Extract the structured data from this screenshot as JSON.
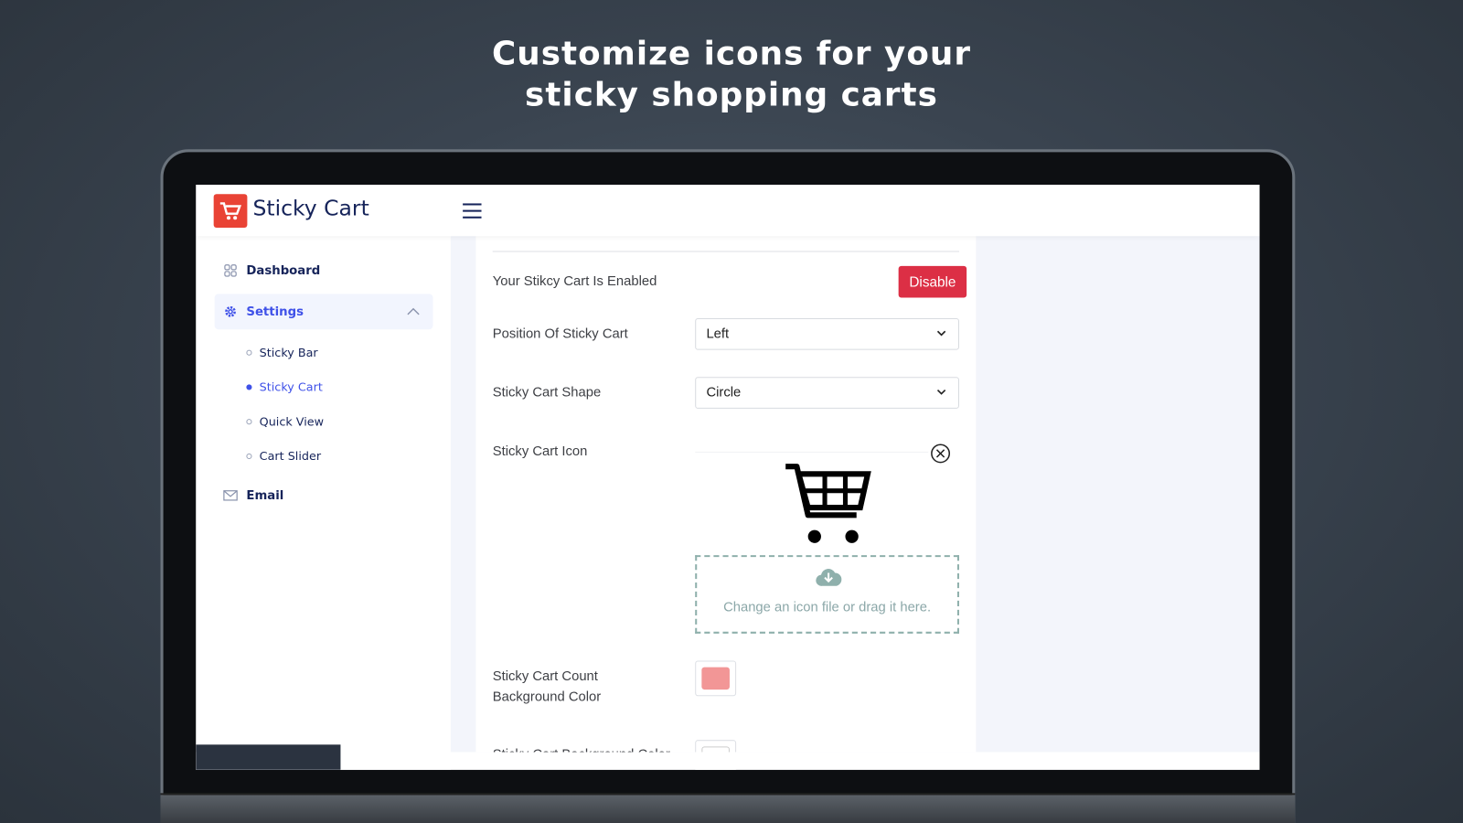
{
  "headline": {
    "line1": "Customize icons for your",
    "line2": "sticky shopping carts"
  },
  "app": {
    "brand": "Sticky Cart",
    "logo_icon": "cart-icon",
    "logo_color": "#e94335",
    "menu_icon": "hamburger-icon"
  },
  "sidebar": {
    "items": [
      {
        "label": "Dashboard",
        "icon": "grid-icon"
      },
      {
        "label": "Settings",
        "icon": "gear-icon",
        "expanded": true,
        "active": true
      },
      {
        "label": "Email",
        "icon": "envelope-icon"
      }
    ],
    "sub_items": [
      {
        "label": "Sticky Bar"
      },
      {
        "label": "Sticky Cart",
        "active": true
      },
      {
        "label": "Quick View"
      },
      {
        "label": "Cart Slider"
      }
    ]
  },
  "form": {
    "status_label": "Your Stikcy Cart Is Enabled",
    "disable_label": "Disable",
    "position_label": "Position Of Sticky Cart",
    "position_value": "Left",
    "shape_label": "Sticky Cart Shape",
    "shape_value": "Circle",
    "icon_label": "Sticky Cart Icon",
    "upload_text": "Change an icon file or drag it here.",
    "count_bg_label_1": "Sticky Cart Count",
    "count_bg_label_2": "Background Color",
    "count_bg_color": "#f29696",
    "bg_label": "Sticky Cart Background Color"
  },
  "colors": {
    "accent": "#3f51e8",
    "danger": "#dc2f45",
    "navy": "#16245a"
  }
}
